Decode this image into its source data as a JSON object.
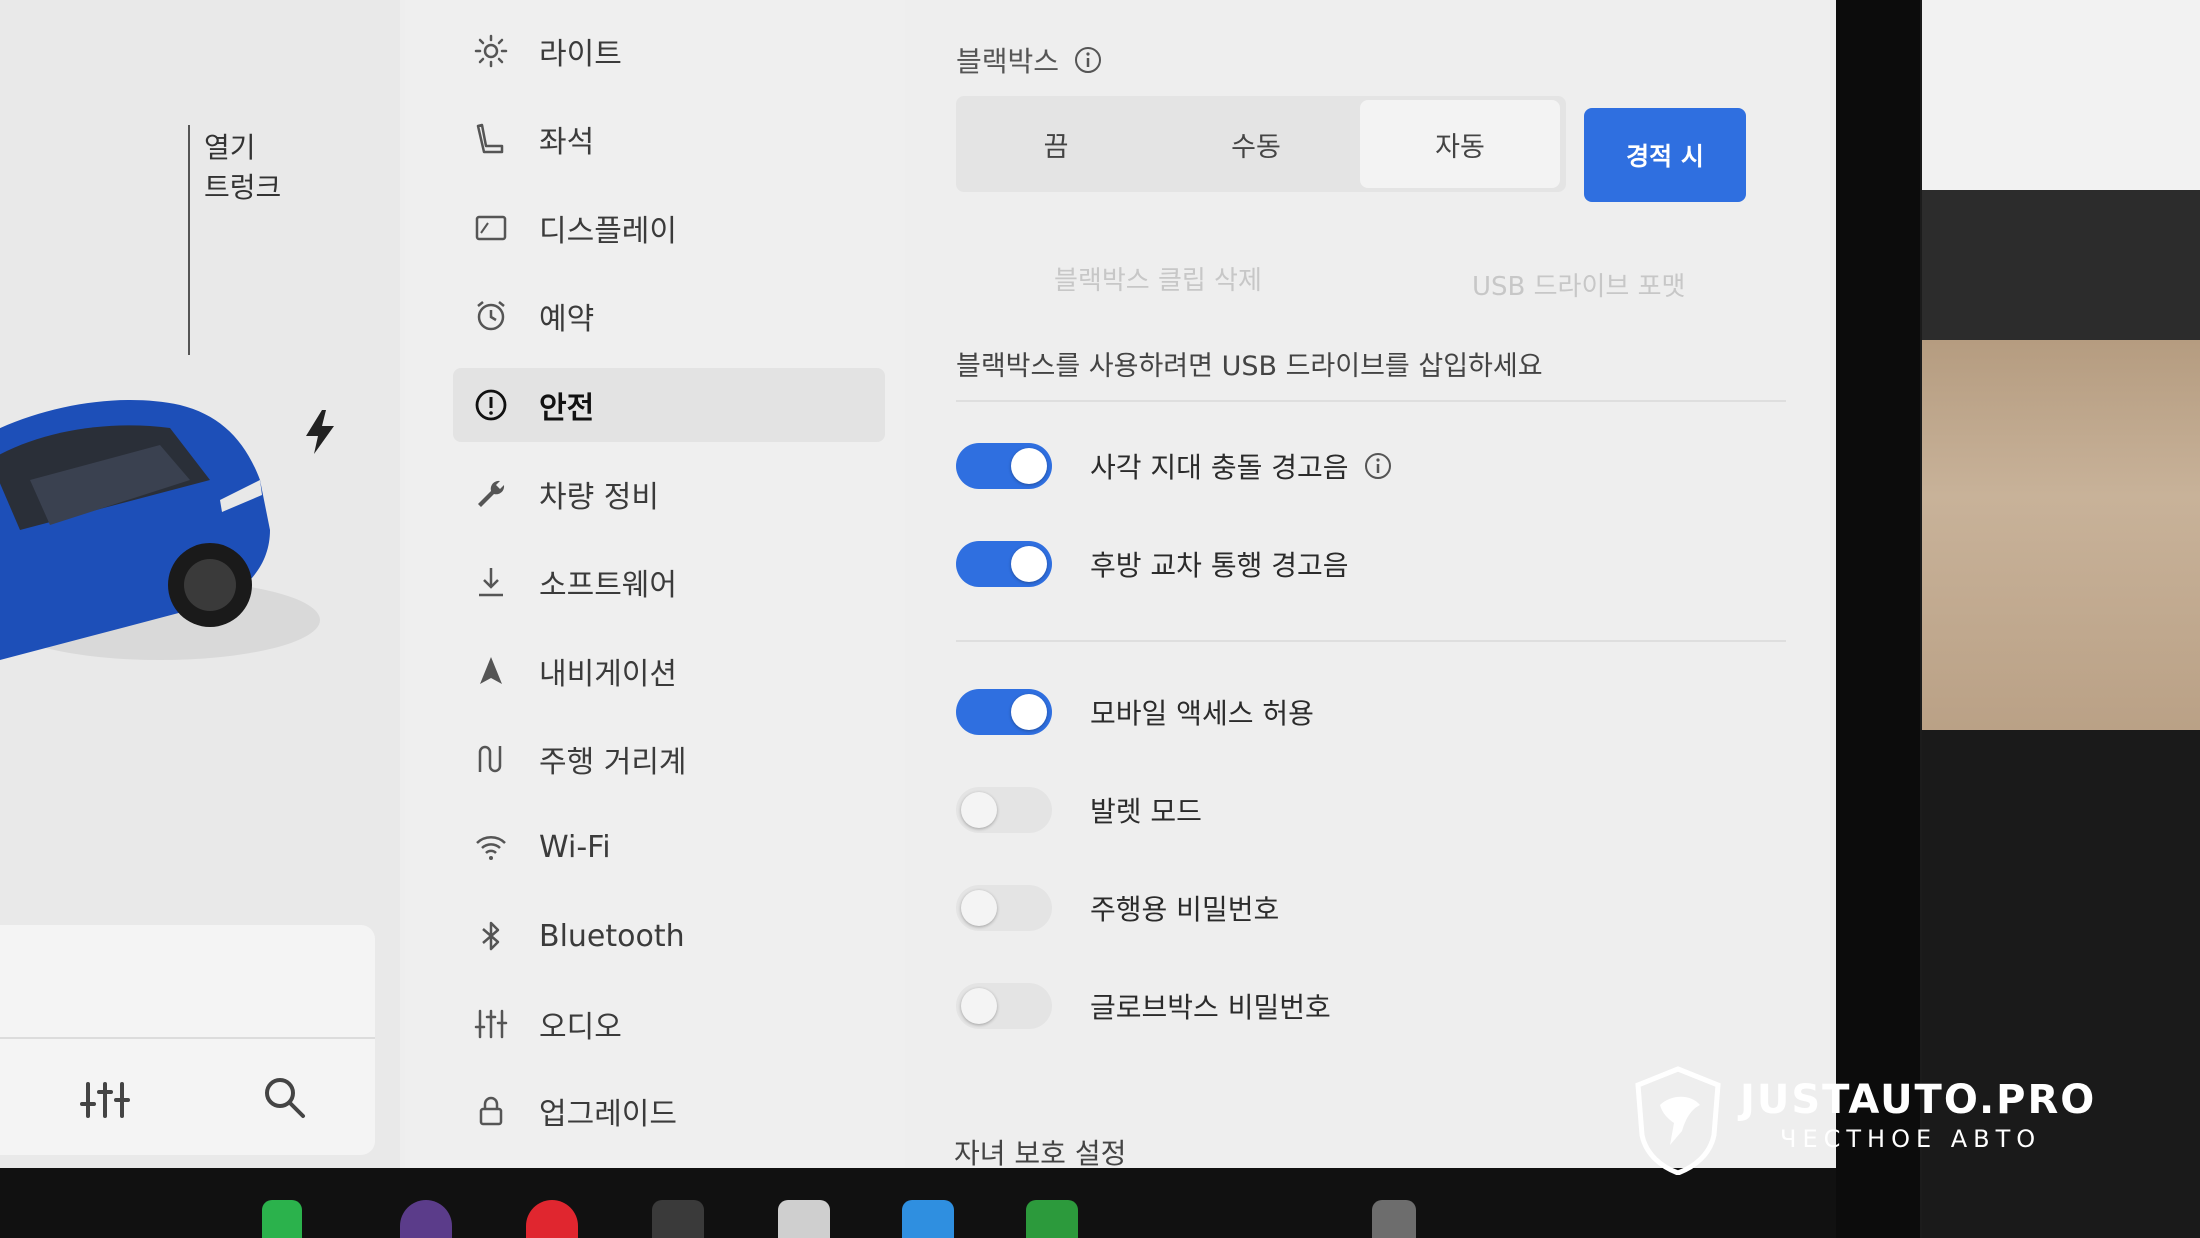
{
  "left_panel": {
    "trunk_label_line1": "열기",
    "trunk_label_line2": "트렁크"
  },
  "menu": {
    "items": [
      {
        "label": "라이트",
        "icon": "sun-icon"
      },
      {
        "label": "좌석",
        "icon": "seat-icon"
      },
      {
        "label": "디스플레이",
        "icon": "display-icon"
      },
      {
        "label": "예약",
        "icon": "alarm-clock-icon"
      },
      {
        "label": "안전",
        "icon": "alert-circle-icon",
        "active": true
      },
      {
        "label": "차량 정비",
        "icon": "wrench-icon"
      },
      {
        "label": "소프트웨어",
        "icon": "download-icon"
      },
      {
        "label": "내비게이션",
        "icon": "navigation-arrow-icon"
      },
      {
        "label": "주행 거리계",
        "icon": "trip-icon"
      },
      {
        "label": "Wi-Fi",
        "icon": "wifi-icon"
      },
      {
        "label": "Bluetooth",
        "icon": "bluetooth-icon"
      },
      {
        "label": "오디오",
        "icon": "equalizer-icon"
      },
      {
        "label": "업그레이드",
        "icon": "lock-icon"
      }
    ]
  },
  "dashcam": {
    "title": "블랙박스",
    "options": [
      "끔",
      "수동",
      "자동"
    ],
    "active_option": "경적 시",
    "delete_clips": "블랙박스 클립 삭제",
    "format_usb": "USB 드라이브 포맷",
    "usb_note": "블랙박스를 사용하려면 USB 드라이브를 삽입하세요"
  },
  "toggles": [
    {
      "label": "사각 지대 충돌 경고음",
      "on": true
    },
    {
      "label": "후방 교차 통행 경고음",
      "on": true
    },
    {
      "label": "모바일 액세스 허용",
      "on": true
    },
    {
      "label": "발렛 모드",
      "on": false
    },
    {
      "label": "주행용 비밀번호",
      "on": false
    },
    {
      "label": "글로브박스 비밀번호",
      "on": false
    }
  ],
  "child_section_title": "자녀 보호 설정",
  "watermark": {
    "title": "JUSTAUTO.PRO",
    "subtitle": "ЧЕСТНОЕ АВТО"
  },
  "colors": {
    "accent": "#2f6fe0",
    "car_body": "#1d4fb8"
  }
}
